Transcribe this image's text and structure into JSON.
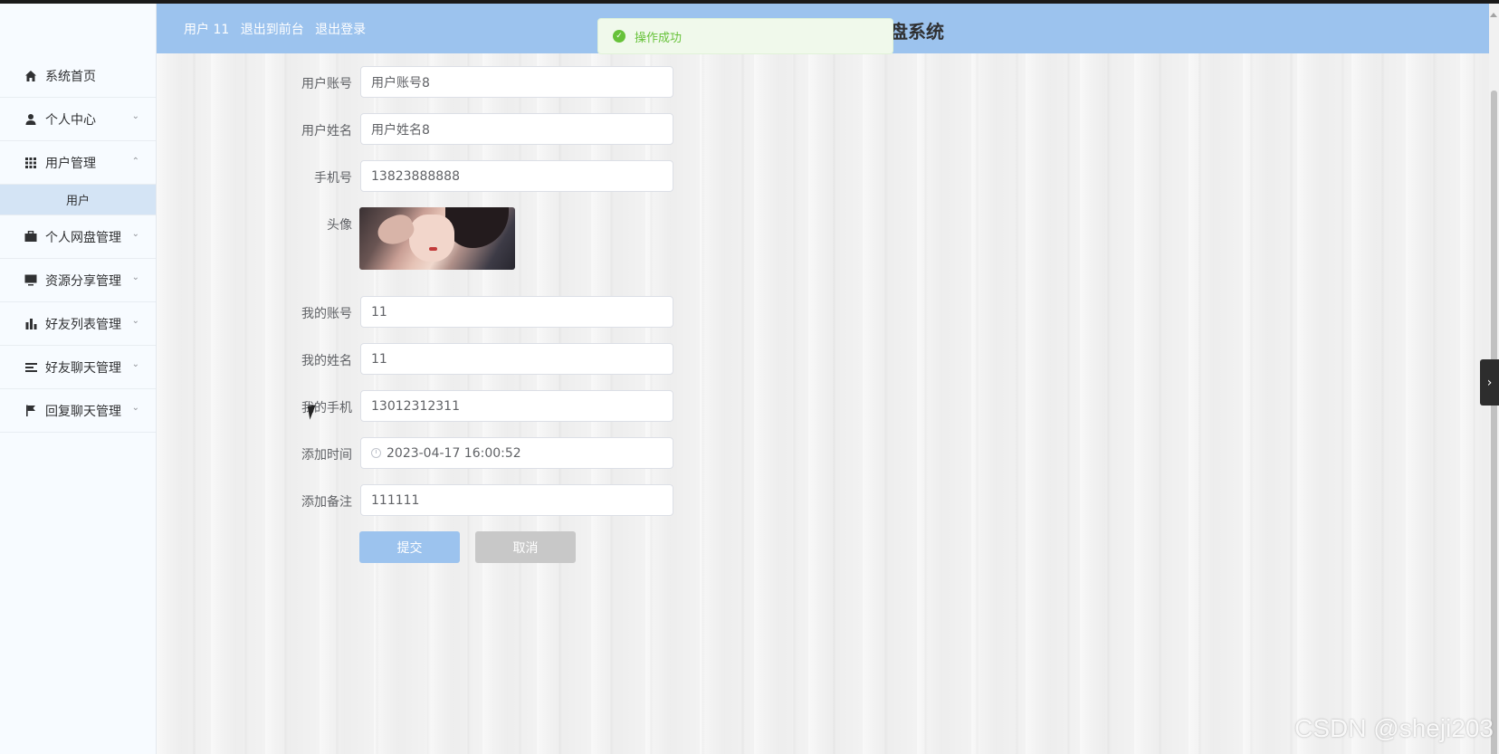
{
  "header": {
    "user_label": "用户 11",
    "front_link": "退出到前台",
    "logout_link": "退出登录",
    "title_fragment": "盘系统"
  },
  "toast": {
    "message": "操作成功"
  },
  "sidebar": {
    "items": [
      {
        "label": "系统首页",
        "icon": "home-icon"
      },
      {
        "label": "个人中心",
        "icon": "user-icon",
        "expandable": true
      },
      {
        "label": "用户管理",
        "icon": "grid-icon",
        "expandable": true,
        "expanded": true
      },
      {
        "label": "个人网盘管理",
        "icon": "briefcase-icon",
        "expandable": true
      },
      {
        "label": "资源分享管理",
        "icon": "monitor-icon",
        "expandable": true
      },
      {
        "label": "好友列表管理",
        "icon": "bar-chart-icon",
        "expandable": true
      },
      {
        "label": "好友聊天管理",
        "icon": "list-icon",
        "expandable": true
      },
      {
        "label": "回复聊天管理",
        "icon": "flag-icon",
        "expandable": true
      }
    ],
    "submenu": {
      "label": "用户"
    }
  },
  "form": {
    "fields": {
      "account": {
        "label": "用户账号",
        "value": "用户账号8"
      },
      "name": {
        "label": "用户姓名",
        "value": "用户姓名8"
      },
      "phone": {
        "label": "手机号",
        "value": "13823888888"
      },
      "avatar": {
        "label": "头像"
      },
      "my_account": {
        "label": "我的账号",
        "value": "11"
      },
      "my_name": {
        "label": "我的姓名",
        "value": "11"
      },
      "my_phone": {
        "label": "我的手机",
        "value": "13012312311"
      },
      "add_time": {
        "label": "添加时间",
        "value": "2023-04-17 16:00:52"
      },
      "remark": {
        "label": "添加备注",
        "value": "111111"
      }
    },
    "submit_label": "提交",
    "cancel_label": "取消"
  },
  "watermark": "CSDN @sheji203",
  "colors": {
    "header": "#9cc3ee",
    "sidebar": "#f7fbff",
    "submenu_active": "#d4e4f5",
    "toast_bg": "#f0f9eb",
    "toast_text": "#67c23a",
    "cancel": "#c8c8c8"
  }
}
